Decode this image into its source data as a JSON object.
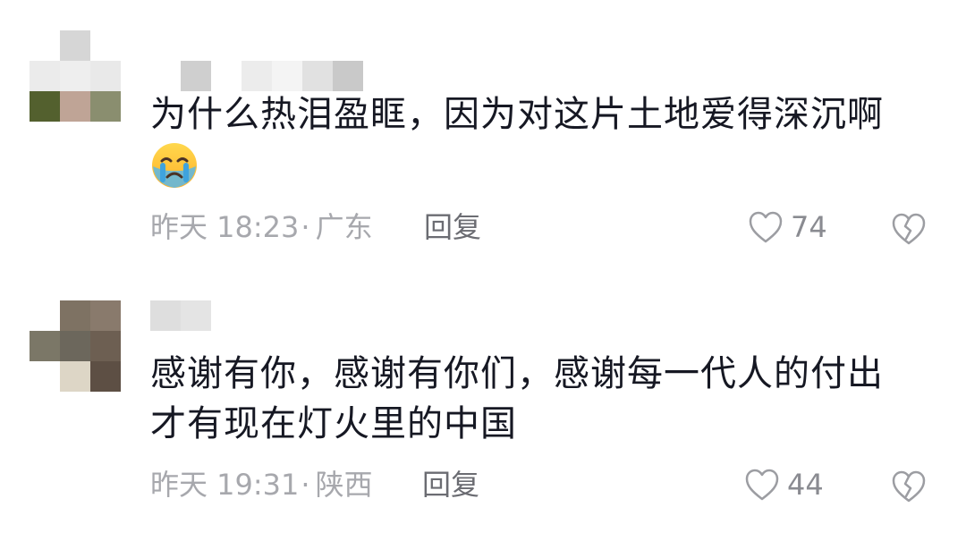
{
  "comments": [
    {
      "text": "为什么热泪盈眶，因为对这片土地爱得深沉啊",
      "emoji": "crying-face",
      "time": "昨天 18:23",
      "location": "广东",
      "reply_label": "回复",
      "likes": "74",
      "avatar_colors": [
        "#ffffff",
        "#d6d6d6",
        "#ffffff",
        "#ebebeb",
        "#eeeeee",
        "#e9e9e9",
        "#53602e",
        "#bfa496",
        "#8a8e6f"
      ]
    },
    {
      "text_line1": "感谢有你，感谢有你们，感谢每一代人的付出",
      "text_line2": "才有现在灯火里的中国",
      "time": "昨天 19:31",
      "location": "陕西",
      "reply_label": "回复",
      "likes": "44",
      "avatar_colors": [
        "#ffffff",
        "#7e7263",
        "#897a6c",
        "#7b7767",
        "#6c675c",
        "#6d5f52",
        "#ffffff",
        "#ddd6c6",
        "#5d4f44"
      ]
    }
  ],
  "separator": "·"
}
